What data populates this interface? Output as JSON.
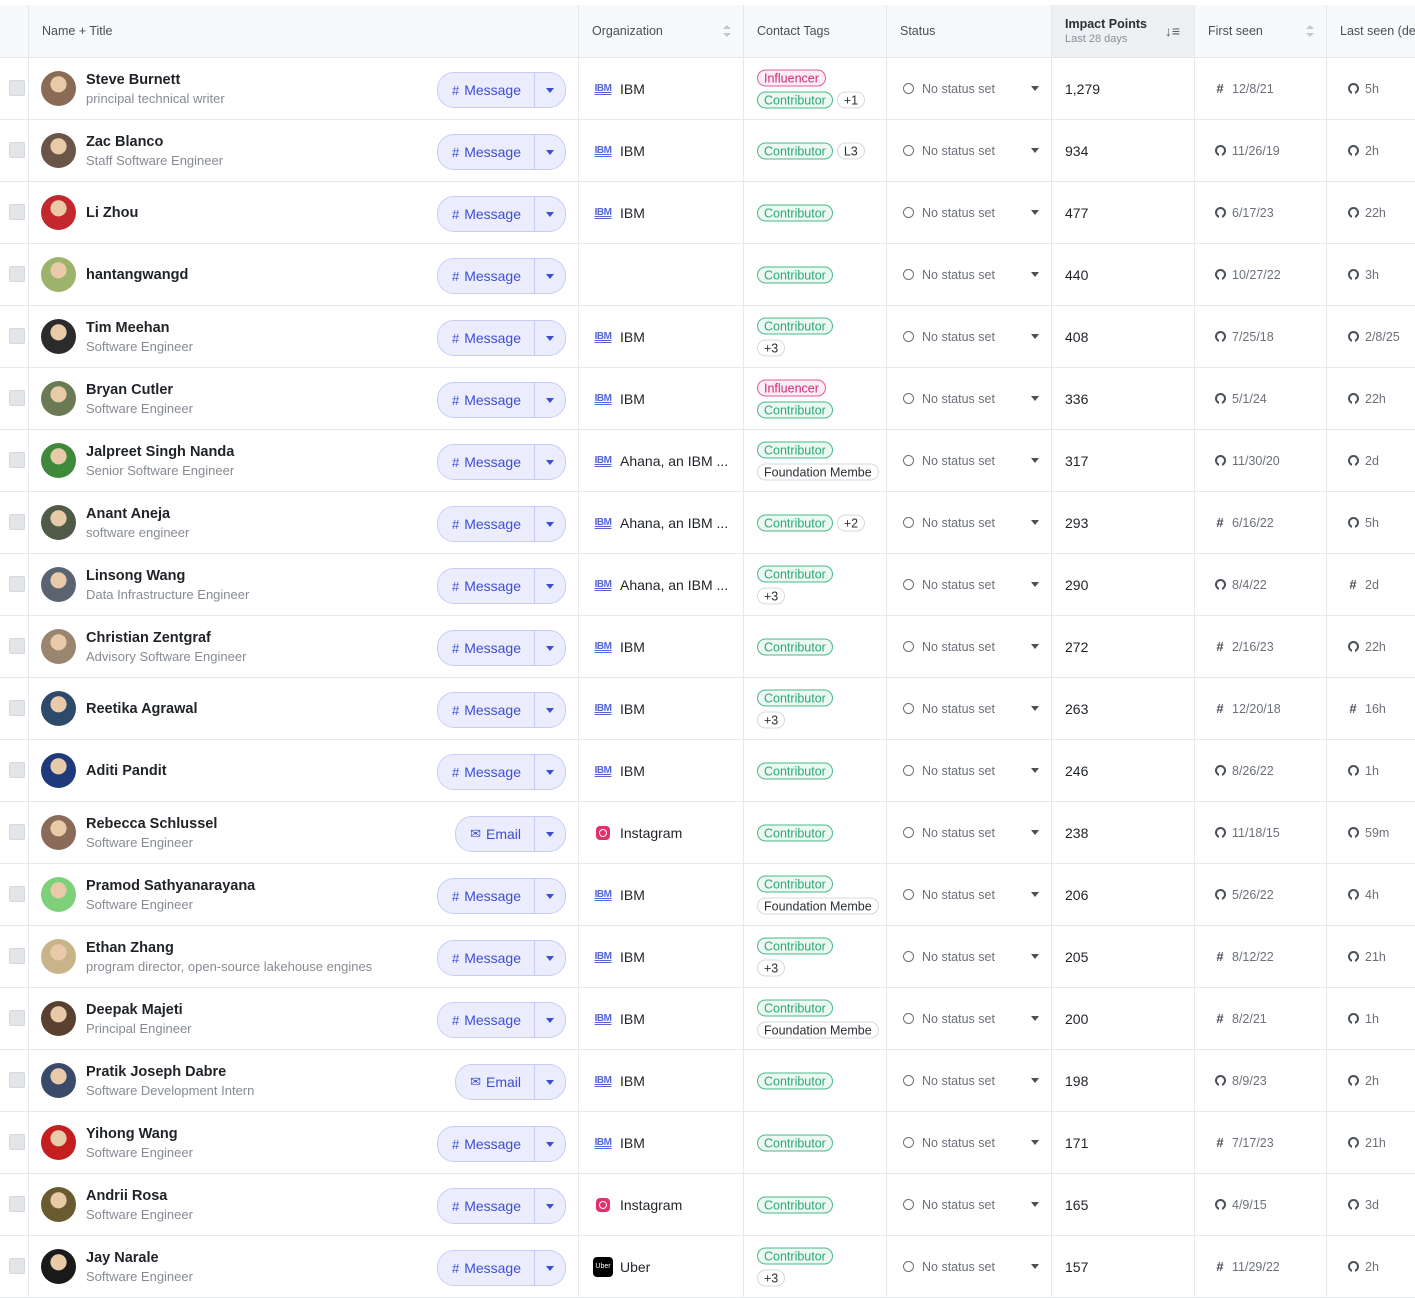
{
  "columns": {
    "name": "Name + Title",
    "org": "Organization",
    "tags": "Contact Tags",
    "status": "Status",
    "impact": "Impact Points",
    "impact_sub": "Last 28 days",
    "first": "First seen",
    "last": "Last seen (de"
  },
  "status_default": "No status set",
  "rows": [
    {
      "name": "Steve Burnett",
      "title": "principal technical writer",
      "action": "Message",
      "org": "IBM",
      "org_logo": "ibm",
      "tags": [
        [
          "Influencer"
        ],
        [
          "Contributor",
          "+1"
        ]
      ],
      "points": "1,279",
      "first": "12/8/21",
      "first_src": "slack",
      "last": "5h",
      "last_src": "github",
      "avatar": "#8a6b55"
    },
    {
      "name": "Zac Blanco",
      "title": "Staff Software Engineer",
      "action": "Message",
      "org": "IBM",
      "org_logo": "ibm",
      "tags": [
        [
          "Contributor",
          "L3"
        ]
      ],
      "points": "934",
      "first": "11/26/19",
      "first_src": "github",
      "last": "2h",
      "last_src": "github",
      "avatar": "#6a5548"
    },
    {
      "name": "Li Zhou",
      "title": "",
      "action": "Message",
      "org": "IBM",
      "org_logo": "ibm",
      "tags": [
        [
          "Contributor"
        ]
      ],
      "points": "477",
      "first": "6/17/23",
      "first_src": "github",
      "last": "22h",
      "last_src": "github",
      "avatar": "#c2282e"
    },
    {
      "name": "hantangwangd",
      "title": "",
      "action": "Message",
      "org": "",
      "org_logo": "",
      "tags": [
        [
          "Contributor"
        ]
      ],
      "points": "440",
      "first": "10/27/22",
      "first_src": "github",
      "last": "3h",
      "last_src": "github",
      "avatar": "#9bb36a"
    },
    {
      "name": "Tim Meehan",
      "title": "Software Engineer",
      "action": "Message",
      "org": "IBM",
      "org_logo": "ibm",
      "tags": [
        [
          "Contributor"
        ],
        [
          "+3"
        ]
      ],
      "points": "408",
      "first": "7/25/18",
      "first_src": "github",
      "last": "2/8/25",
      "last_src": "github",
      "avatar": "#2b2b2b"
    },
    {
      "name": "Bryan Cutler",
      "title": "Software Engineer",
      "action": "Message",
      "org": "IBM",
      "org_logo": "ibm",
      "tags": [
        [
          "Influencer"
        ],
        [
          "Contributor"
        ]
      ],
      "points": "336",
      "first": "5/1/24",
      "first_src": "github",
      "last": "22h",
      "last_src": "github",
      "avatar": "#6a7a55"
    },
    {
      "name": "Jalpreet Singh Nanda",
      "title": "Senior Software Engineer",
      "action": "Message",
      "org": "Ahana, an IBM ...",
      "org_logo": "ibm",
      "tags": [
        [
          "Contributor"
        ],
        [
          "Foundation Membe"
        ]
      ],
      "points": "317",
      "first": "11/30/20",
      "first_src": "github",
      "last": "2d",
      "last_src": "github",
      "avatar": "#3f8a3a"
    },
    {
      "name": "Anant Aneja",
      "title": "software engineer",
      "action": "Message",
      "org": "Ahana, an IBM ...",
      "org_logo": "ibm",
      "tags": [
        [
          "Contributor",
          "+2"
        ]
      ],
      "points": "293",
      "first": "6/16/22",
      "first_src": "slack",
      "last": "5h",
      "last_src": "github",
      "avatar": "#4f5a48"
    },
    {
      "name": "Linsong Wang",
      "title": "Data Infrastructure Engineer",
      "action": "Message",
      "org": "Ahana, an IBM ...",
      "org_logo": "ibm",
      "tags": [
        [
          "Contributor"
        ],
        [
          "+3"
        ]
      ],
      "points": "290",
      "first": "8/4/22",
      "first_src": "github",
      "last": "2d",
      "last_src": "slack",
      "avatar": "#5a6470"
    },
    {
      "name": "Christian Zentgraf",
      "title": "Advisory Software Engineer",
      "action": "Message",
      "org": "IBM",
      "org_logo": "ibm",
      "tags": [
        [
          "Contributor"
        ]
      ],
      "points": "272",
      "first": "2/16/23",
      "first_src": "slack",
      "last": "22h",
      "last_src": "github",
      "avatar": "#9a8570"
    },
    {
      "name": "Reetika Agrawal",
      "title": "",
      "action": "Message",
      "org": "IBM",
      "org_logo": "ibm",
      "tags": [
        [
          "Contributor"
        ],
        [
          "+3"
        ]
      ],
      "points": "263",
      "first": "12/20/18",
      "first_src": "slack",
      "last": "16h",
      "last_src": "slack",
      "avatar": "#2e4a6a"
    },
    {
      "name": "Aditi Pandit",
      "title": "",
      "action": "Message",
      "org": "IBM",
      "org_logo": "ibm",
      "tags": [
        [
          "Contributor"
        ]
      ],
      "points": "246",
      "first": "8/26/22",
      "first_src": "github",
      "last": "1h",
      "last_src": "github",
      "avatar": "#1f3a7a"
    },
    {
      "name": "Rebecca Schlussel",
      "title": "Software Engineer",
      "action": "Email",
      "org": "Instagram",
      "org_logo": "instagram",
      "tags": [
        [
          "Contributor"
        ]
      ],
      "points": "238",
      "first": "11/18/15",
      "first_src": "github",
      "last": "59m",
      "last_src": "github",
      "avatar": "#8a6a58"
    },
    {
      "name": "Pramod Sathyanarayana",
      "title": "Software Engineer",
      "action": "Message",
      "org": "IBM",
      "org_logo": "ibm",
      "tags": [
        [
          "Contributor"
        ],
        [
          "Foundation Membe"
        ]
      ],
      "points": "206",
      "first": "5/26/22",
      "first_src": "github",
      "last": "4h",
      "last_src": "github",
      "avatar": "#7ed07a"
    },
    {
      "name": "Ethan Zhang",
      "title": "program director, open-source lakehouse engines",
      "action": "Message",
      "org": "IBM",
      "org_logo": "ibm",
      "tags": [
        [
          "Contributor"
        ],
        [
          "+3"
        ]
      ],
      "points": "205",
      "first": "8/12/22",
      "first_src": "slack",
      "last": "21h",
      "last_src": "github",
      "avatar": "#c9b48a"
    },
    {
      "name": "Deepak Majeti",
      "title": "Principal Engineer",
      "action": "Message",
      "org": "IBM",
      "org_logo": "ibm",
      "tags": [
        [
          "Contributor"
        ],
        [
          "Foundation Membe"
        ]
      ],
      "points": "200",
      "first": "8/2/21",
      "first_src": "slack",
      "last": "1h",
      "last_src": "github",
      "avatar": "#5a4030"
    },
    {
      "name": "Pratik Joseph Dabre",
      "title": "Software Development Intern",
      "action": "Email",
      "org": "IBM",
      "org_logo": "ibm",
      "tags": [
        [
          "Contributor"
        ]
      ],
      "points": "198",
      "first": "8/9/23",
      "first_src": "github",
      "last": "2h",
      "last_src": "github",
      "avatar": "#3a4a6a"
    },
    {
      "name": "Yihong Wang",
      "title": "Software Engineer",
      "action": "Message",
      "org": "IBM",
      "org_logo": "ibm",
      "tags": [
        [
          "Contributor"
        ]
      ],
      "points": "171",
      "first": "7/17/23",
      "first_src": "slack",
      "last": "21h",
      "last_src": "github",
      "avatar": "#c41e1e"
    },
    {
      "name": "Andrii Rosa",
      "title": "Software Engineer",
      "action": "Message",
      "org": "Instagram",
      "org_logo": "instagram",
      "tags": [
        [
          "Contributor"
        ]
      ],
      "points": "165",
      "first": "4/9/15",
      "first_src": "github",
      "last": "3d",
      "last_src": "github",
      "avatar": "#6a5a30"
    },
    {
      "name": "Jay Narale",
      "title": "Software Engineer",
      "action": "Message",
      "org": "Uber",
      "org_logo": "uber",
      "tags": [
        [
          "Contributor"
        ],
        [
          "+3"
        ]
      ],
      "points": "157",
      "first": "11/29/22",
      "first_src": "slack",
      "last": "2h",
      "last_src": "github",
      "avatar": "#1a1a1a"
    }
  ]
}
